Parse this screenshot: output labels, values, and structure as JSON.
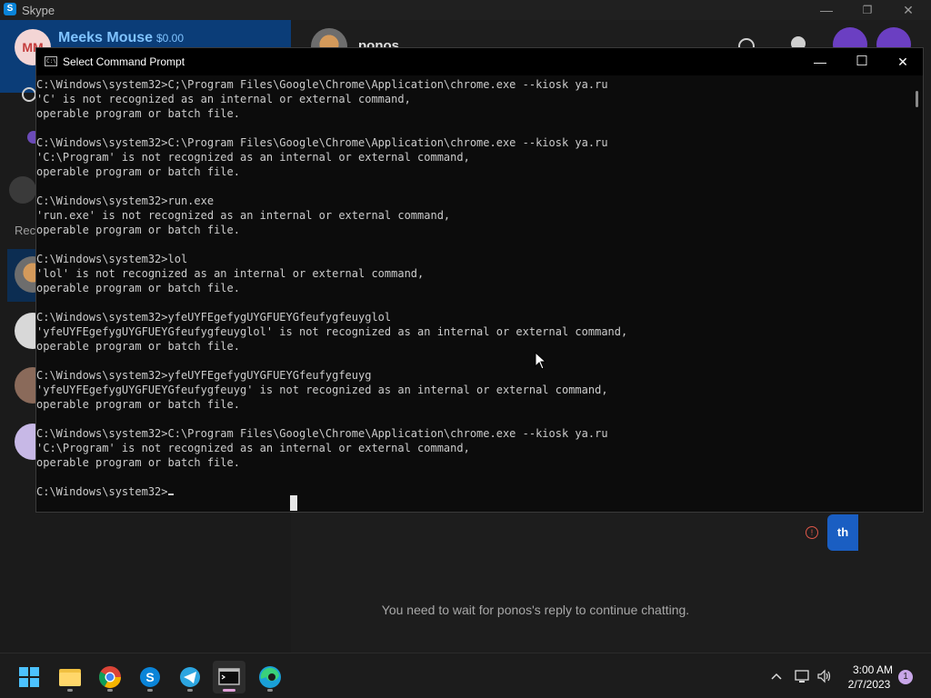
{
  "skype": {
    "window_title": "Skype",
    "logo_letter": "S",
    "window_controls": {
      "minimize": "—",
      "restore": "❐",
      "close": "✕"
    },
    "profile": {
      "initials": "MM",
      "name": "Meeks Mouse",
      "credit": "$0.00"
    },
    "recent_label": "Rec",
    "chat": {
      "contact_name": "ponos",
      "sent_message": "th",
      "error_mark": "!",
      "notice": "You need to wait for ponos's reply to continue chatting."
    },
    "colors": {
      "accent": "#0b3d78",
      "bubble": "#1a5ec2",
      "call_button": "#6b3fc2"
    }
  },
  "cmd": {
    "title": "Select Command Prompt",
    "icon_text": "C:\\",
    "controls": {
      "minimize": "—",
      "maximize": "☐",
      "close": "✕"
    },
    "lines": [
      "C:\\Windows\\system32>C;\\Program Files\\Google\\Chrome\\Application\\chrome.exe --kiosk ya.ru",
      "'C' is not recognized as an internal or external command,",
      "operable program or batch file.",
      "",
      "C:\\Windows\\system32>C:\\Program Files\\Google\\Chrome\\Application\\chrome.exe --kiosk ya.ru",
      "'C:\\Program' is not recognized as an internal or external command,",
      "operable program or batch file.",
      "",
      "C:\\Windows\\system32>run.exe",
      "'run.exe' is not recognized as an internal or external command,",
      "operable program or batch file.",
      "",
      "C:\\Windows\\system32>lol",
      "'lol' is not recognized as an internal or external command,",
      "operable program or batch file.",
      "",
      "C:\\Windows\\system32>yfeUYFEgefygUYGFUEYGfeufygfeuyglol",
      "'yfeUYFEgefygUYGFUEYGfeufygfeuyglol' is not recognized as an internal or external command,",
      "operable program or batch file.",
      "",
      "C:\\Windows\\system32>yfeUYFEgefygUYGFUEYGfeufygfeuyg",
      "'yfeUYFEgefygUYGFUEYGfeufygfeuyg' is not recognized as an internal or external command,",
      "operable program or batch file.",
      "",
      "C:\\Windows\\system32>C:\\Program Files\\Google\\Chrome\\Application\\chrome.exe --kiosk ya.ru",
      "'C:\\Program' is not recognized as an internal or external command,",
      "operable program or batch file.",
      ""
    ],
    "prompt": "C:\\Windows\\system32>"
  },
  "taskbar": {
    "apps": [
      {
        "name": "windows-start-icon",
        "active": false
      },
      {
        "name": "file-explorer-icon",
        "active": true
      },
      {
        "name": "chrome-icon",
        "active": true
      },
      {
        "name": "skype-icon",
        "active": true
      },
      {
        "name": "telegram-icon",
        "active": true
      },
      {
        "name": "terminal-icon",
        "active": true
      },
      {
        "name": "edge-icon",
        "active": true
      }
    ],
    "clock_time": "3:00 AM",
    "clock_date": "2/7/2023",
    "notification_count": "1"
  }
}
